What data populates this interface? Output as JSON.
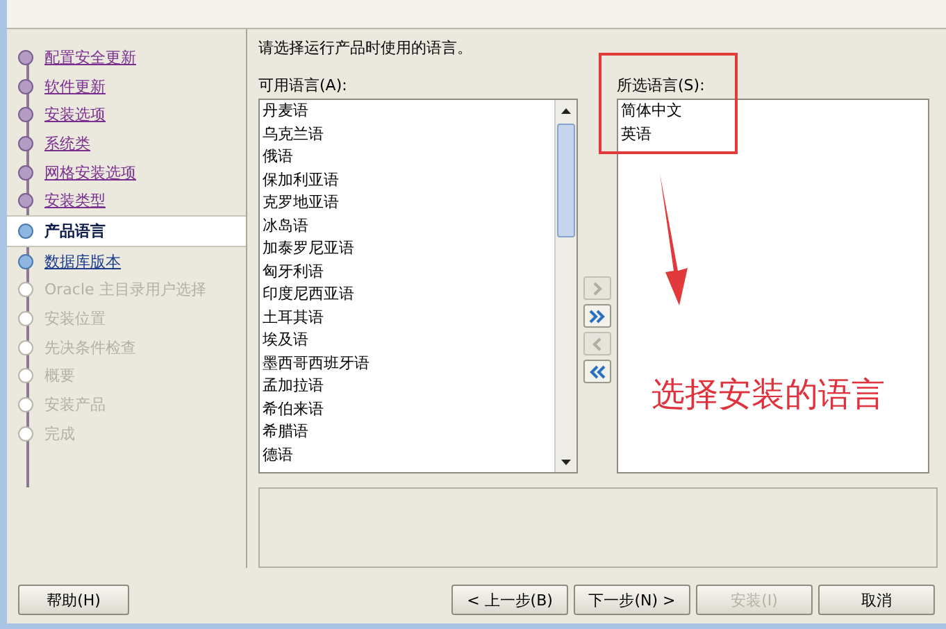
{
  "steps": [
    {
      "label": "配置安全更新",
      "kind": "done",
      "selected": false
    },
    {
      "label": "软件更新",
      "kind": "done",
      "selected": false
    },
    {
      "label": "安装选项",
      "kind": "done",
      "selected": false
    },
    {
      "label": "系统类",
      "kind": "done",
      "selected": false
    },
    {
      "label": "网格安装选项",
      "kind": "done",
      "selected": false
    },
    {
      "label": "安装类型",
      "kind": "done",
      "selected": false
    },
    {
      "label": "产品语言",
      "kind": "current",
      "selected": true
    },
    {
      "label": "数据库版本",
      "kind": "next",
      "selected": false
    },
    {
      "label": "Oracle 主目录用户选择",
      "kind": "pending",
      "selected": false
    },
    {
      "label": "安装位置",
      "kind": "pending",
      "selected": false
    },
    {
      "label": "先决条件检查",
      "kind": "pending",
      "selected": false
    },
    {
      "label": "概要",
      "kind": "pending",
      "selected": false
    },
    {
      "label": "安装产品",
      "kind": "pending",
      "selected": false
    },
    {
      "label": "完成",
      "kind": "pending",
      "selected": false
    }
  ],
  "instruction": "请选择运行产品时使用的语言。",
  "available": {
    "label": "可用语言(A):",
    "items": [
      "丹麦语",
      "乌克兰语",
      "俄语",
      "保加利亚语",
      "克罗地亚语",
      "冰岛语",
      "加泰罗尼亚语",
      "匈牙利语",
      "印度尼西亚语",
      "土耳其语",
      "埃及语",
      "墨西哥西班牙语",
      "孟加拉语",
      "希伯来语",
      "希腊语",
      "德语"
    ]
  },
  "move_buttons": [
    {
      "kind": "add",
      "disabled": true
    },
    {
      "kind": "add_all",
      "disabled": false
    },
    {
      "kind": "remove",
      "disabled": true
    },
    {
      "kind": "remove_all",
      "disabled": false
    }
  ],
  "selected_languages": {
    "label": "所选语言(S):",
    "items": [
      "简体中文",
      "英语"
    ]
  },
  "annotation": {
    "text": "选择安装的语言"
  },
  "buttons": [
    {
      "label": "帮助(H)",
      "kind": "help",
      "disabled": false
    },
    {
      "label": "< 上一步(B)",
      "kind": "nav",
      "disabled": false
    },
    {
      "label": "下一步(N) >",
      "kind": "nav",
      "disabled": false
    },
    {
      "label": "安装(I)",
      "kind": "nav",
      "disabled": true
    },
    {
      "label": "取消",
      "kind": "cancel",
      "disabled": false
    }
  ]
}
